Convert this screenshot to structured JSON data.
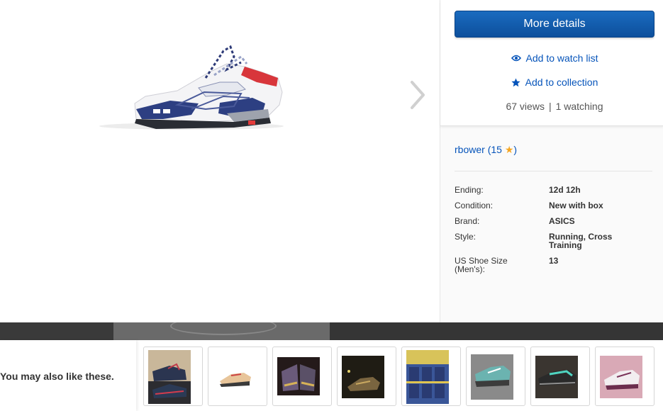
{
  "actions": {
    "more_details": "More details",
    "watch": "Add to watch list",
    "collection": "Add to collection",
    "views": "67 views",
    "separator": "|",
    "watching": "1 watching"
  },
  "seller": {
    "name": "rbower",
    "open_paren": "(",
    "score": "15",
    "close_paren": ")"
  },
  "specs": [
    {
      "label": "Ending:",
      "value": "12d 12h"
    },
    {
      "label": "Condition:",
      "value": "New with box"
    },
    {
      "label": "Brand:",
      "value": "ASICS"
    },
    {
      "label": "Style:",
      "value": "Running, Cross Training"
    },
    {
      "label": "US Shoe Size (Men's):",
      "value": "13"
    }
  ],
  "reco": {
    "title": "You may also like these."
  },
  "colors": {
    "accent": "#0654ba",
    "button": "#0d4f9c",
    "star": "#f5a623"
  },
  "icons": {
    "watch": "eye-icon",
    "collection": "star-icon",
    "next": "chevron-right-icon"
  }
}
